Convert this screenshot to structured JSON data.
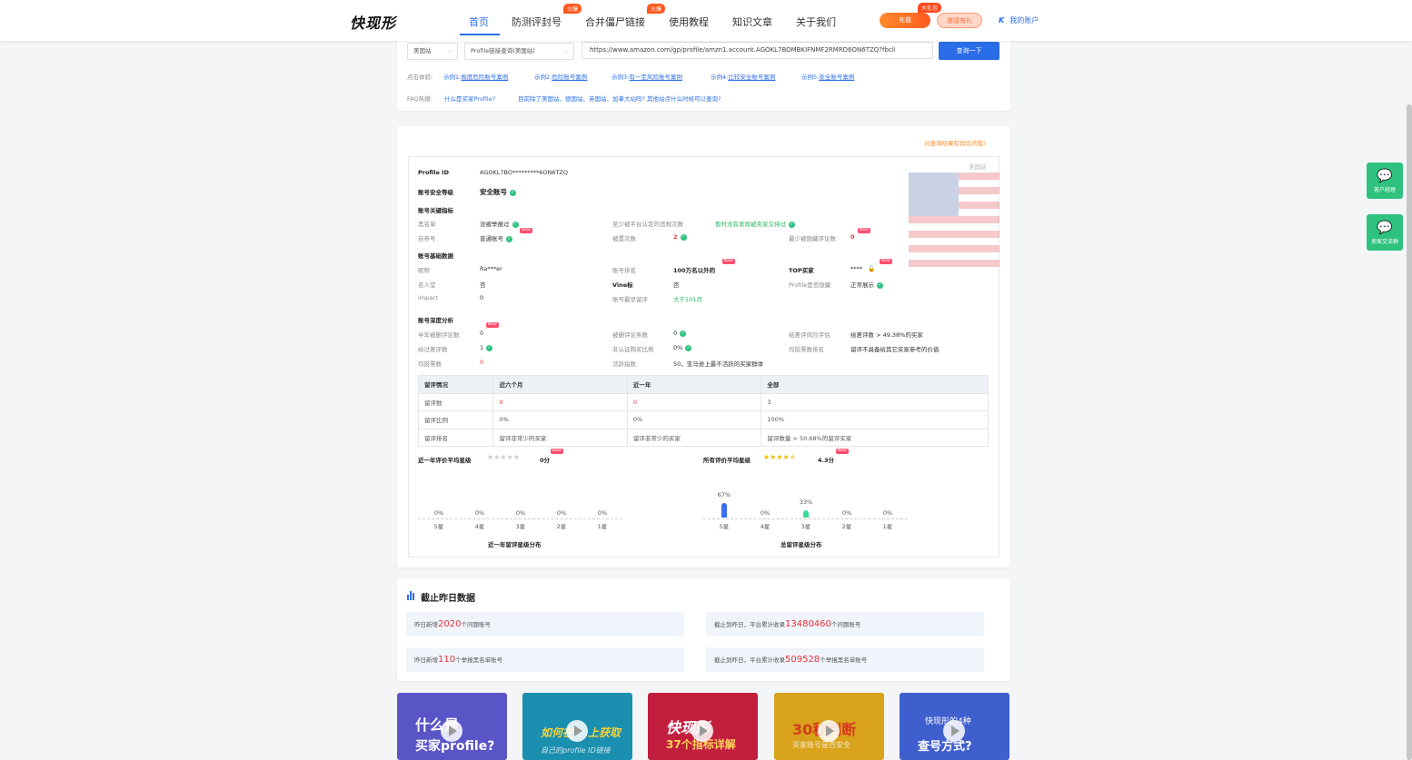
{
  "header": {
    "logo": "快现形",
    "nav": [
      "首页",
      "防测评封号",
      "合并僵尸链接",
      "使用教程",
      "知识文章",
      "关于我们"
    ],
    "hot_tag": "火爆",
    "recharge": "充值",
    "invite": "邀请有礼",
    "gift_tag": "大礼包",
    "account": "我的账户"
  },
  "search": {
    "site": "美国站",
    "mode": "Profile链接查询(美国站)",
    "url": "https://www.amazon.com/gp/profile/amzn1.account.AGOKL7BOMBKIFNMF2RMRD6ON6TZQ?fbcli",
    "query_btn": "查询一下",
    "new": "New",
    "try_label": "点击体验:",
    "examples": [
      {
        "prefix": "示例1:",
        "text": "极度危险账号案例"
      },
      {
        "prefix": "示例2:",
        "text": "危险账号案例"
      },
      {
        "prefix": "示例3:",
        "text": "有一定风险账号案例"
      },
      {
        "prefix": "示例4:",
        "text": "比较安全账号案例"
      },
      {
        "prefix": "示例5:",
        "text": "安全账号案例"
      }
    ],
    "faq_label": "FAQ热搜:",
    "faq": [
      "什么是买家Profile?",
      "目前除了美国站、德国站、英国站、加拿大站吗? 其他站点什么时候可以查询?"
    ]
  },
  "result": {
    "objection": "对查询结果有异议点我?",
    "site_tag": "美国站",
    "profile_id_label": "Profile ID",
    "profile_id": "AGOKL7BO*********6ON6TZQ",
    "level_label": "账号安全等级",
    "level": "安全账号",
    "key_title": "账号关键指标",
    "blacklist_label": "黑名单",
    "blacklist": "没被举报过",
    "self_label": "自养号",
    "self": "普通账号",
    "violation_label": "至少被平台认定的违规次数",
    "violation": "暂时没有发现被卖家交待过",
    "deleted_label": "被置次数",
    "deleted": "2",
    "hidden_label": "最少被隐藏评论数",
    "hidden": "0",
    "basic_title": "账号基础数据",
    "nick_label": "昵称",
    "nick": "Ra***er",
    "fame_label": "名人堂",
    "fame": "否",
    "impact_label": "impact",
    "impact": "0",
    "rank_label": "账号排名",
    "rank": "100万名以外的",
    "vine_label": "Vine标",
    "vine": "否",
    "age_label": "账号最早留评",
    "age": "大于101月",
    "top_label": "TOP买家",
    "top": "****",
    "hidden_profile_label": "Profile是否隐藏",
    "hidden_profile": "正常展示",
    "deep_title": "账号深度分析",
    "half_label": "半年被删评论数",
    "half": "0",
    "bad_label": "给过差评数",
    "bad": "1",
    "avg_label": "均投票数",
    "avg": "0",
    "del_count_label": "被删评论条数",
    "del_count": "0",
    "unverified_label": "非认证购买比例",
    "unverified": "0%",
    "active_label": "活跃指数",
    "active": "50，亚马逊上最不活跃的买家群体",
    "risk_label": "给差评风险评估",
    "risk": "给差评数 > 49.38%的买家",
    "vote_rank_label": "均投票数排名",
    "vote_rank": "留评不具备给其它买家参考的价值",
    "table": {
      "headers": [
        "留评情况",
        "近六个月",
        "近一年",
        "全部"
      ],
      "rows": [
        [
          "留评数",
          "0",
          "0",
          "3"
        ],
        [
          "留评比例",
          "0%",
          "0%",
          "100%"
        ],
        [
          "留评排名",
          "留评非常少的买家",
          "留评非常少的买家",
          "留评数量 > 50.68%的留评买家"
        ]
      ]
    },
    "year_star_label": "近一年评价平均星级",
    "year_star": "0分",
    "all_star_label": "所有评价平均星级",
    "all_star": "4.3分"
  },
  "chart_data": [
    {
      "type": "bar",
      "title": "近一年留评星级分布",
      "categories": [
        "5星",
        "4星",
        "3星",
        "2星",
        "1星"
      ],
      "values": [
        0,
        0,
        0,
        0,
        0
      ],
      "labels": [
        "0%",
        "0%",
        "0%",
        "0%",
        "0%"
      ],
      "colors": [
        "#3b6ef0",
        "#3b6ef0",
        "#3ddc97",
        "#3b6ef0",
        "#3b6ef0"
      ]
    },
    {
      "type": "bar",
      "title": "总留评星级分布",
      "categories": [
        "5星",
        "4星",
        "3星",
        "2星",
        "1星"
      ],
      "values": [
        67,
        0,
        33,
        0,
        0
      ],
      "labels": [
        "67%",
        "0%",
        "33%",
        "0%",
        "0%"
      ],
      "colors": [
        "#3b6ef0",
        "#3b6ef0",
        "#3ddc97",
        "#3b6ef0",
        "#3b6ef0"
      ]
    }
  ],
  "stats": {
    "title": "截止昨日数据",
    "items": [
      {
        "pre": "昨日新增",
        "num": "2020",
        "post": "个问题账号"
      },
      {
        "pre": "截止到昨日，平台累计收录",
        "num": "13480460",
        "post": "个问题账号"
      },
      {
        "pre": "昨日新增",
        "num": "110",
        "post": "个举报黑名单账号"
      },
      {
        "pre": "截止到昨日，平台累计收录",
        "num": "509528",
        "post": "个举报黑名单账号"
      }
    ]
  },
  "videos": [
    {
      "l1": "什么是",
      "l2": "买家profile?",
      "bg": "#5a55c7"
    },
    {
      "l1": "如何在",
      "l2": "上获取",
      "l3": "自己的profile ID链接",
      "bg": "#1b8fb0"
    },
    {
      "l1": "快现形",
      "l2": "37个指标详解",
      "bg": "#c21f3e"
    },
    {
      "l1": "30秒判断",
      "l2": "买家账号是否安全",
      "bg": "#d8a21a"
    },
    {
      "l1": "快现形的4种",
      "l2": "查号方式?",
      "bg": "#3f5fcf"
    }
  ],
  "side": {
    "service": "客户经理",
    "seller": "卖家交流群"
  }
}
